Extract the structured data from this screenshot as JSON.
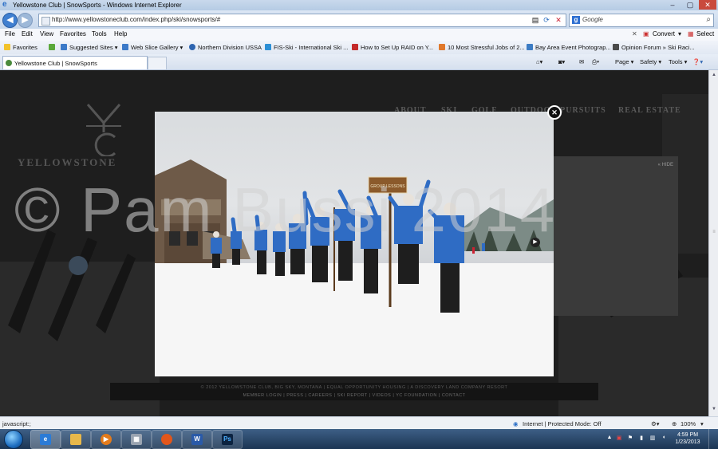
{
  "window": {
    "title": "Yellowstone Club | SnowSports - Windows Internet Explorer"
  },
  "address": {
    "url": "http://www.yellowstoneclub.com/index.php/ski/snowsports/#"
  },
  "search": {
    "placeholder": "Google"
  },
  "menu": [
    "File",
    "Edit",
    "View",
    "Favorites",
    "Tools",
    "Help"
  ],
  "menu_right": {
    "convert": "Convert",
    "select": "Select"
  },
  "favorites": {
    "label": "Favorites",
    "items": [
      "Suggested Sites ▾",
      "Web Slice Gallery ▾",
      "Northern Division USSA",
      "FIS-Ski - International Ski ...",
      "How to Set Up RAID on Y...",
      "10 Most Stressful Jobs of 2...",
      "Bay Area Event Photograp...",
      "Opinion Forum » Ski Raci..."
    ]
  },
  "tab": {
    "label": "Yellowstone Club | SnowSports"
  },
  "commands": {
    "page": "Page ▾",
    "safety": "Safety ▾",
    "tools": "Tools ▾"
  },
  "site": {
    "nav": [
      "ABOUT",
      "SKI",
      "GOLF",
      "OUTDOOR PURSUITS",
      "REAL ESTATE"
    ],
    "logo_text": "YELLOWSTONE",
    "panel_hide": "« HIDE",
    "footer_line1": "© 2012 YELLOWSTONE CLUB, BIG SKY, MONTANA  |  EQUAL OPPORTUNITY HOUSING  |  A DISCOVERY LAND COMPANY RESORT",
    "footer_line2": "MEMBER LOGIN  |  PRESS  |  CAREERS  |  SKI REPORT  |  VIDEOS  |  YC FOUNDATION  |  CONTACT"
  },
  "photo": {
    "sign_text": "GROUP LESSONS"
  },
  "watermark": "© Pam Bussi 2014",
  "status": {
    "left": "javascript:;",
    "zone": "Internet | Protected Mode: Off",
    "zoom": "100%"
  },
  "taskbar": {
    "apps": [
      "ie",
      "explorer",
      "media-player",
      "calculator",
      "firefox",
      "word",
      "photoshop"
    ],
    "time": "4:59 PM",
    "date": "1/23/2013"
  }
}
